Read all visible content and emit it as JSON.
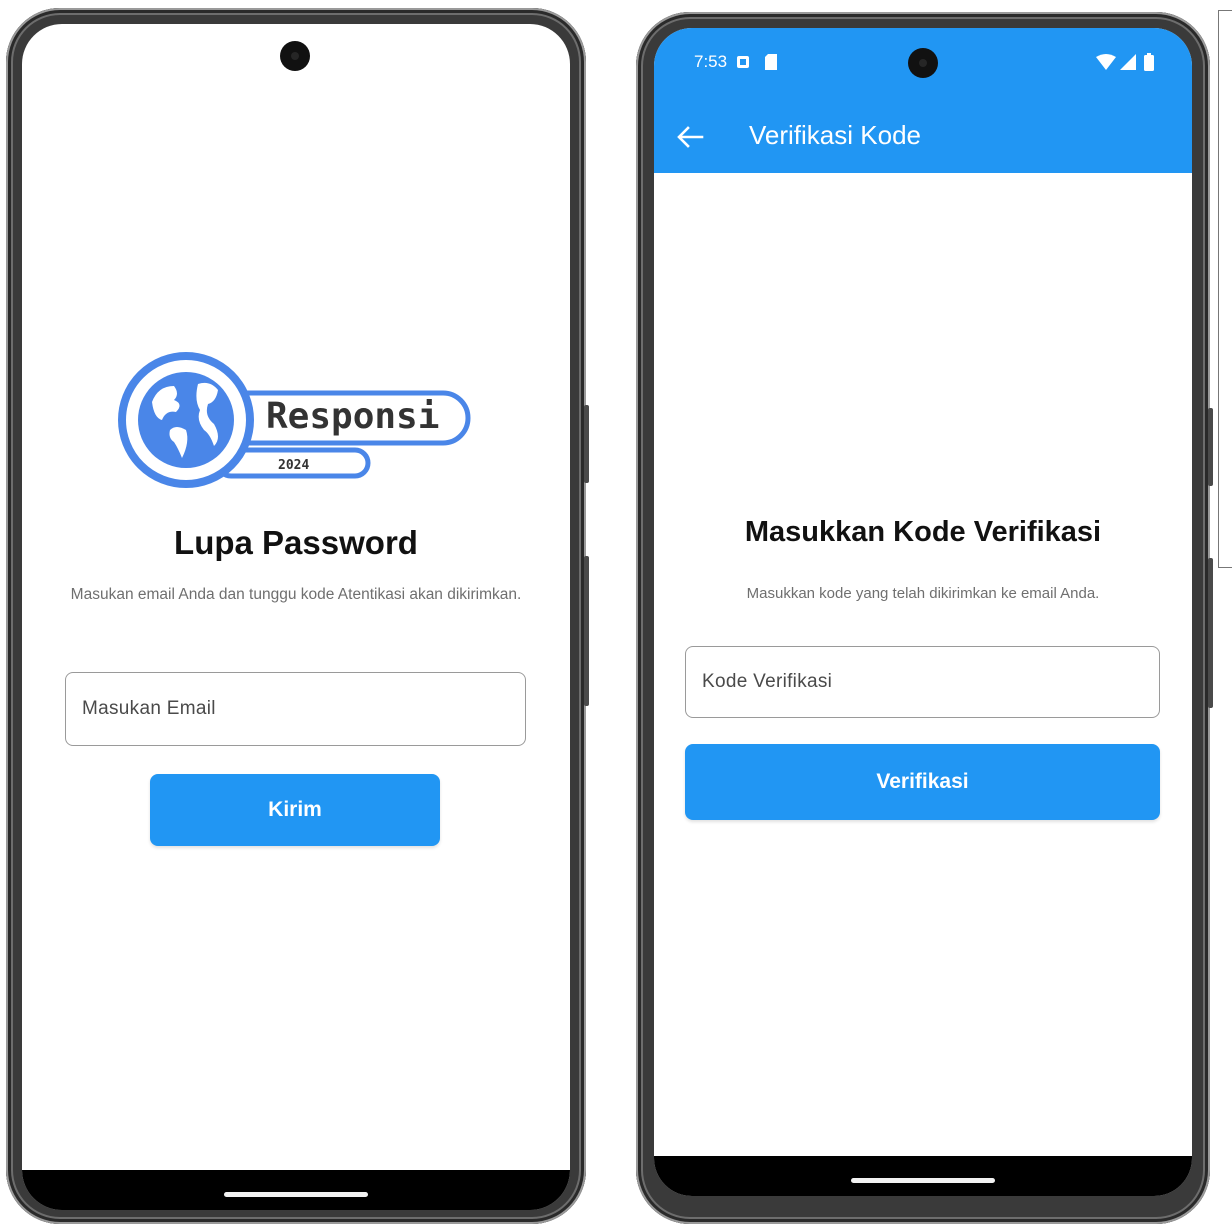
{
  "screens": {
    "forgot_password": {
      "logo": {
        "brand": "Responsi",
        "year": "2024",
        "color": "#4a86e8"
      },
      "title": "Lupa Password",
      "subtitle": "Masukan email Anda dan tunggu kode Atentikasi akan dikirimkan.",
      "email_input": {
        "placeholder": "Masukan Email",
        "value": ""
      },
      "submit_button": "Kirim"
    },
    "verify_code": {
      "status_bar": {
        "time": "7:53"
      },
      "app_bar": {
        "title": "Verifikasi Kode",
        "back_icon": "arrow-back-icon"
      },
      "title": "Masukkan Kode Verifikasi",
      "subtitle": "Masukkan kode yang telah dikirimkan ke email Anda.",
      "code_input": {
        "placeholder": "Kode Verifikasi",
        "value": ""
      },
      "submit_button": "Verifikasi"
    }
  },
  "colors": {
    "primary": "#2196F3",
    "logo_blue": "#4a86e8",
    "frame": "#3a3a3a"
  }
}
